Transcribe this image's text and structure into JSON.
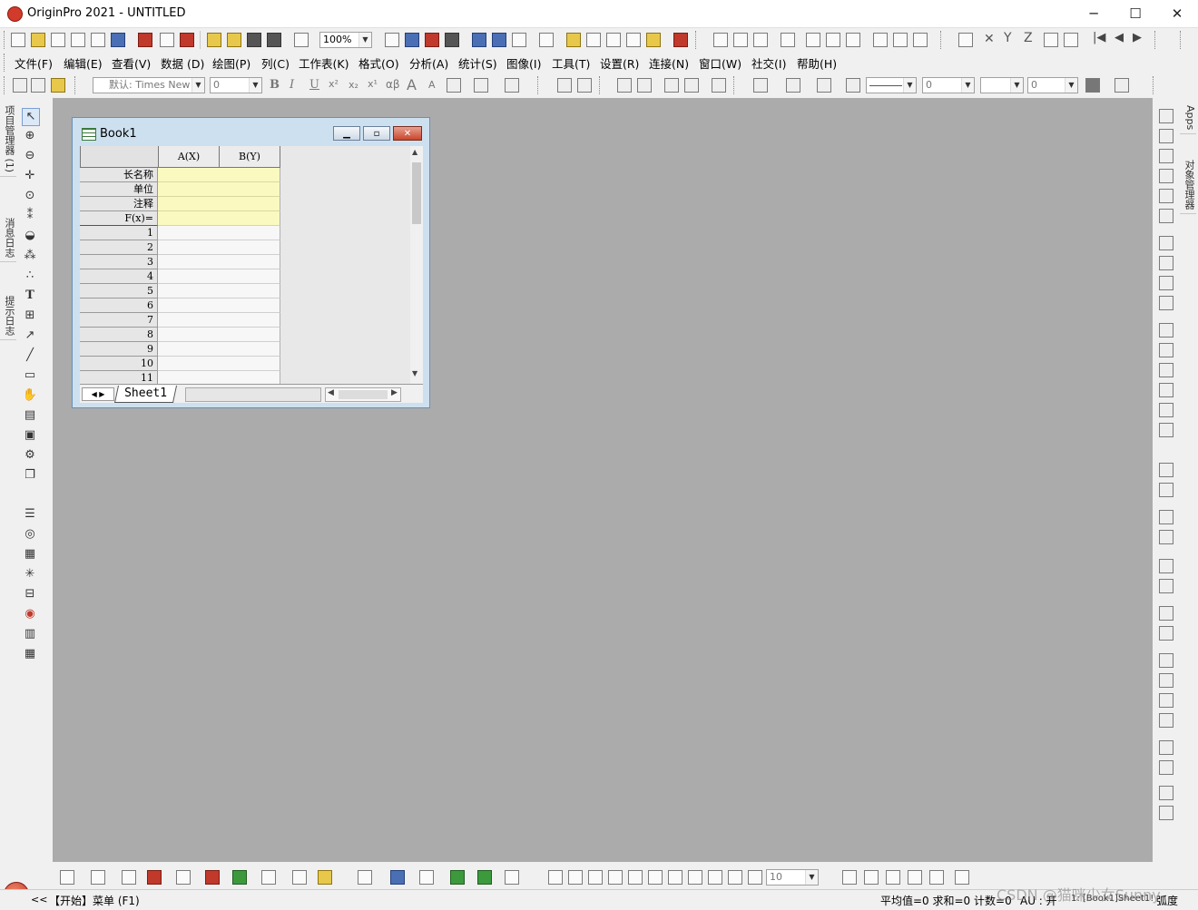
{
  "window": {
    "title": "OriginPro 2021 - UNTITLED",
    "controls": [
      "─",
      "☐",
      "✕"
    ]
  },
  "toolbar": {
    "zoom": "100%",
    "font_name": "默认: Times New",
    "font_size": "0",
    "line_width": "0",
    "fill_value": "0",
    "text_buttons": [
      "B",
      "I",
      "U",
      "x²",
      "x₂",
      "x¹",
      "αβ",
      "A",
      "A"
    ],
    "axis_labels": [
      "X",
      "Y",
      "Z"
    ],
    "bottom_value": "10"
  },
  "menu": [
    "文件(F)",
    "编辑(E)",
    "查看(V)",
    "数据 (D)",
    "绘图(P)",
    "列(C)",
    "工作表(K)",
    "格式(O)",
    "分析(A)",
    "统计(S)",
    "图像(I)",
    "工具(T)",
    "设置(R)",
    "连接(N)",
    "窗口(W)",
    "社交(I)",
    "帮助(H)"
  ],
  "left_dock": {
    "tabs": [
      "项目管理器 (1)",
      "消息日志",
      "提示日志"
    ]
  },
  "right_dock": {
    "tabs": [
      "Apps",
      "对象管理器"
    ]
  },
  "book": {
    "title": "Book1",
    "columns": [
      "A(X)",
      "B(Y)"
    ],
    "meta_rows": [
      "长名称",
      "单位",
      "注释",
      "F(x)="
    ],
    "rows": [
      "1",
      "2",
      "3",
      "4",
      "5",
      "6",
      "7",
      "8",
      "9",
      "10",
      "11"
    ],
    "sheet_tab": "Sheet1"
  },
  "status": {
    "nav": "<<",
    "start": "【开始】菜单 (F1)",
    "stats": "平均值=0 求和=0 计数=0",
    "au": "AU : 开",
    "sheet": "1: [Book1]Sheet1!",
    "unit": "弧度",
    "watermark": "CSDN @猫咪少女Sunny"
  },
  "colors": {
    "workspace": "#ababab",
    "meta_fill": "#fafac0",
    "accent": "#c0392b"
  }
}
